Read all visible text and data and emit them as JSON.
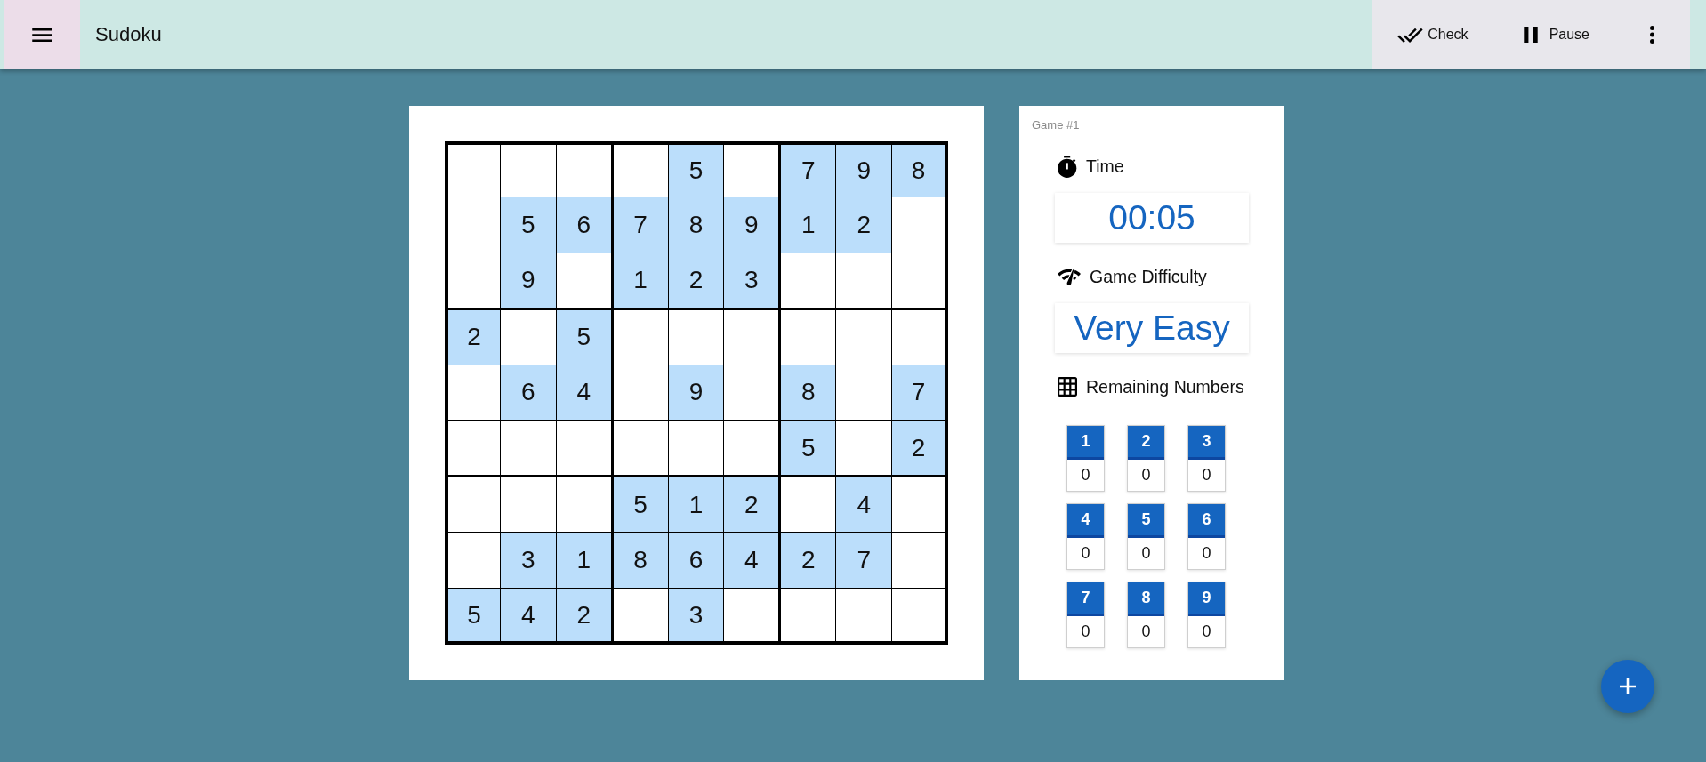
{
  "app_bar": {
    "title": "Sudoku",
    "actions": [
      {
        "kind": "check",
        "label": "Check"
      },
      {
        "kind": "pause",
        "label": "Pause"
      }
    ]
  },
  "board": {
    "rows": [
      [
        {
          "highlighted": false
        },
        {
          "highlighted": false
        },
        {
          "highlighted": false
        },
        {
          "highlighted": false
        },
        {
          "value": "5",
          "highlighted": true
        },
        {
          "highlighted": false
        },
        {
          "value": "7",
          "highlighted": true
        },
        {
          "value": "9",
          "highlighted": true
        },
        {
          "value": "8",
          "highlighted": true
        }
      ],
      [
        {
          "highlighted": false
        },
        {
          "value": "5",
          "highlighted": true
        },
        {
          "value": "6",
          "highlighted": true
        },
        {
          "value": "7",
          "highlighted": true
        },
        {
          "value": "8",
          "highlighted": true
        },
        {
          "value": "9",
          "highlighted": true
        },
        {
          "value": "1",
          "highlighted": true
        },
        {
          "value": "2",
          "highlighted": true
        },
        {
          "highlighted": false
        }
      ],
      [
        {
          "highlighted": false
        },
        {
          "value": "9",
          "highlighted": true
        },
        {
          "highlighted": false
        },
        {
          "value": "1",
          "highlighted": true
        },
        {
          "value": "2",
          "highlighted": true
        },
        {
          "value": "3",
          "highlighted": true
        },
        {
          "highlighted": false
        },
        {
          "highlighted": false
        },
        {
          "highlighted": false
        }
      ],
      [
        {
          "value": "2",
          "highlighted": true
        },
        {
          "highlighted": false
        },
        {
          "value": "5",
          "highlighted": true
        },
        {
          "highlighted": false
        },
        {
          "highlighted": false
        },
        {
          "highlighted": false
        },
        {
          "highlighted": false
        },
        {
          "highlighted": false
        },
        {
          "highlighted": false
        }
      ],
      [
        {
          "highlighted": false
        },
        {
          "value": "6",
          "highlighted": true
        },
        {
          "value": "4",
          "highlighted": true
        },
        {
          "highlighted": false
        },
        {
          "value": "9",
          "highlighted": true
        },
        {
          "highlighted": false
        },
        {
          "value": "8",
          "highlighted": true
        },
        {
          "highlighted": false
        },
        {
          "value": "7",
          "highlighted": true
        }
      ],
      [
        {
          "highlighted": false
        },
        {
          "highlighted": false
        },
        {
          "highlighted": false
        },
        {
          "highlighted": false
        },
        {
          "highlighted": false
        },
        {
          "highlighted": false
        },
        {
          "value": "5",
          "highlighted": true
        },
        {
          "highlighted": false
        },
        {
          "value": "2",
          "highlighted": true
        }
      ],
      [
        {
          "highlighted": false
        },
        {
          "highlighted": false
        },
        {
          "highlighted": false
        },
        {
          "value": "5",
          "highlighted": true
        },
        {
          "value": "1",
          "highlighted": true
        },
        {
          "value": "2",
          "highlighted": true
        },
        {
          "highlighted": false
        },
        {
          "value": "4",
          "highlighted": true
        },
        {
          "highlighted": false
        }
      ],
      [
        {
          "highlighted": false
        },
        {
          "value": "3",
          "highlighted": true
        },
        {
          "value": "1",
          "highlighted": true
        },
        {
          "value": "8",
          "highlighted": true
        },
        {
          "value": "6",
          "highlighted": true
        },
        {
          "value": "4",
          "highlighted": true
        },
        {
          "value": "2",
          "highlighted": true
        },
        {
          "value": "7",
          "highlighted": true
        },
        {
          "highlighted": false
        }
      ],
      [
        {
          "value": "5",
          "highlighted": true
        },
        {
          "value": "4",
          "highlighted": true
        },
        {
          "value": "2",
          "highlighted": true
        },
        {
          "highlighted": false
        },
        {
          "value": "3",
          "highlighted": true
        },
        {
          "highlighted": false
        },
        {
          "highlighted": false
        },
        {
          "highlighted": false
        },
        {
          "highlighted": false
        }
      ]
    ]
  },
  "info_panel": {
    "game_label": "Game #1",
    "time": {
      "label": "Time",
      "value": "00:05"
    },
    "difficulty": {
      "label": "Game Difficulty",
      "value": "Very Easy"
    },
    "remaining_numbers": {
      "label": "Remaining Numbers",
      "tiles": [
        {
          "number": "1",
          "count": "0"
        },
        {
          "number": "2",
          "count": "0"
        },
        {
          "number": "3",
          "count": "0"
        },
        {
          "number": "4",
          "count": "0"
        },
        {
          "number": "5",
          "count": "0"
        },
        {
          "number": "6",
          "count": "0"
        },
        {
          "number": "7",
          "count": "0"
        },
        {
          "number": "8",
          "count": "0"
        },
        {
          "number": "9",
          "count": "0"
        }
      ]
    }
  }
}
